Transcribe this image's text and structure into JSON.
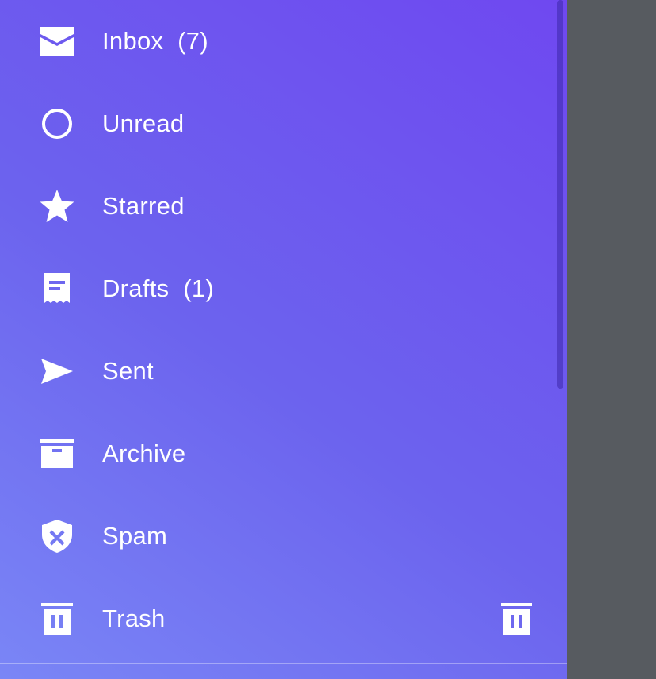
{
  "colors": {
    "drawer_gradient_start": "#7a86f6",
    "drawer_gradient_end": "#6f48f0",
    "scrim": "#575b60",
    "text": "#ffffff"
  },
  "menu": {
    "items": [
      {
        "label": "Inbox  (7)",
        "icon": "mail-icon"
      },
      {
        "label": "Unread",
        "icon": "circle-outline-icon"
      },
      {
        "label": "Starred",
        "icon": "star-icon"
      },
      {
        "label": "Drafts  (1)",
        "icon": "draft-icon"
      },
      {
        "label": "Sent",
        "icon": "send-icon"
      },
      {
        "label": "Archive",
        "icon": "archive-icon"
      },
      {
        "label": "Spam",
        "icon": "spam-shield-icon"
      },
      {
        "label": "Trash",
        "icon": "trash-icon",
        "trailing_icon": "empty-trash-icon"
      }
    ]
  }
}
